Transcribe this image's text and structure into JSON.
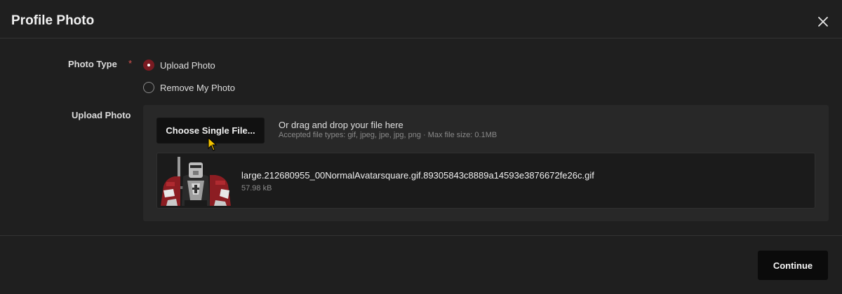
{
  "dialog": {
    "title": "Profile Photo",
    "close_icon": "close-icon"
  },
  "photo_type": {
    "label": "Photo Type",
    "required_marker": "*",
    "options": [
      {
        "label": "Upload Photo",
        "selected": true
      },
      {
        "label": "Remove My Photo",
        "selected": false
      }
    ]
  },
  "upload": {
    "label": "Upload Photo",
    "choose_button": "Choose Single File...",
    "drag_text": "Or drag and drop your file here",
    "accepted_text": "Accepted file types: gif, jpeg, jpe, jpg, png · Max file size: 0.1MB",
    "file": {
      "name": "large.212680955_00NormalAvatarsquare.gif.89305843c8889a14593e3876672fe26c.gif",
      "size": "57.98 kB",
      "thumbnail_icon": "armored-knight-avatar"
    }
  },
  "footer": {
    "continue_button": "Continue"
  },
  "colors": {
    "background": "#1f1f1f",
    "accent": "#7a1b22",
    "required": "#d9534f",
    "button_dark": "#0b0b0b"
  }
}
